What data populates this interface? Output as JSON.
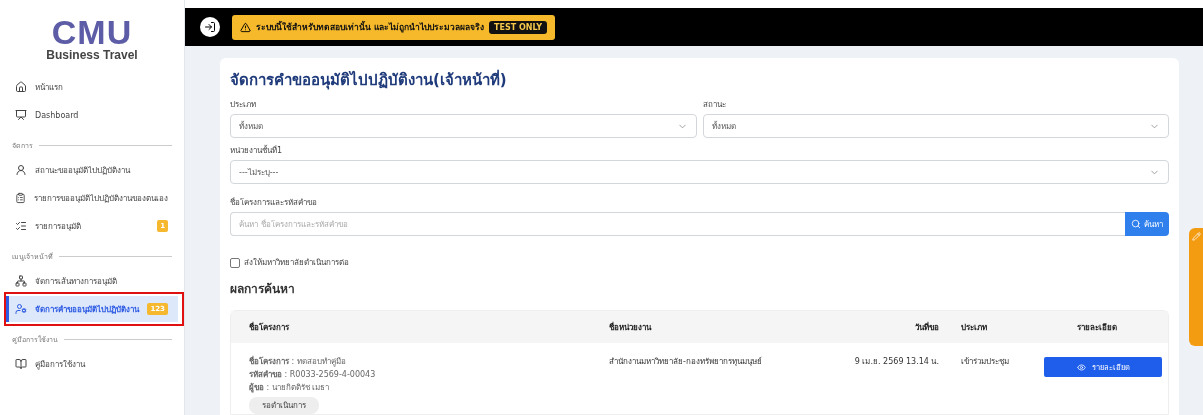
{
  "sidebar": {
    "logo": "CMU",
    "subtitle": "Business Travel",
    "sections": [
      {
        "items": [
          {
            "label": "หน้าแรก",
            "selected": false
          },
          {
            "label": "Dashboard",
            "selected": false
          }
        ]
      },
      {
        "heading": "จัดการ",
        "items": [
          {
            "label": "สถานะขออนุมัติไปปฏิบัติงาน",
            "selected": false
          },
          {
            "label": "รายการขออนุมัติไปปฏิบัติงานของตนเอง",
            "selected": false
          },
          {
            "label": "รายการอนุมัติ",
            "selected": false,
            "badge": "1"
          }
        ]
      },
      {
        "heading": "เมนูเจ้าหน้าที่",
        "items": [
          {
            "label": "จัดการเส้นทางการอนุมัติ",
            "selected": false
          },
          {
            "label": "จัดการคำขออนุมัติไปปฏิบัติงาน",
            "selected": true,
            "badge": "123",
            "annotated": true
          }
        ]
      },
      {
        "heading": "คู่มือการใช้งาน",
        "items": [
          {
            "label": "คู่มือการใช้งาน",
            "selected": false
          }
        ]
      }
    ]
  },
  "banner": {
    "text": "ระบบนี้ใช้สำหรับทดสอบเท่านั้น และไม่ถูกนำไปประมวลผลจริง",
    "tag": "TEST ONLY"
  },
  "page": {
    "title": "จัดการคำขออนุมัติไปปฏิบัติงาน(เจ้าหน้าที่)",
    "filters": {
      "type": {
        "label": "ประเภท",
        "value": "ทั้งหมด"
      },
      "status": {
        "label": "สถานะ",
        "value": "ทั้งหมด"
      },
      "unit": {
        "label": "หน่วยงานชั้นที่1",
        "value": "---ไม่ระบุ---"
      },
      "search": {
        "label": "ชื่อโครงการและรหัสคำขอ",
        "placeholder": "ค้นหา ชื่อโครงการและรหัสคำขอ",
        "button": "ค้นหา"
      }
    },
    "checkbox": {
      "label": "ส่งให้มหาวิทยาลัยดำเนินการต่อ",
      "checked": false
    },
    "results_heading": "ผลการค้นหา",
    "table": {
      "columns": [
        "ชื่อโครงการ",
        "ชื่อหน่วยงาน",
        "วันที่ขอ",
        "ประเภท",
        "รายละเอียด"
      ],
      "rows": [
        {
          "details": [
            {
              "label": "ชื่อโครงการ",
              "value": ": ทดสอบทำคู่มือ"
            },
            {
              "label": "รหัสคำขอ",
              "value": ": R0033-2569-4-00043"
            },
            {
              "label": "ผู้ขอ",
              "value": ": นายกิตติรัช เมธา"
            }
          ],
          "status": "รอดำเนินการ",
          "unit": "สำนักงานมหาวิทยาลัย-กองทรัพยากรทุนมนุษย์",
          "date": "9 เม.ย. 2569  13.14 น.",
          "type": "เข้าร่วมประชุม",
          "button": "รายละเอียด"
        }
      ]
    }
  }
}
